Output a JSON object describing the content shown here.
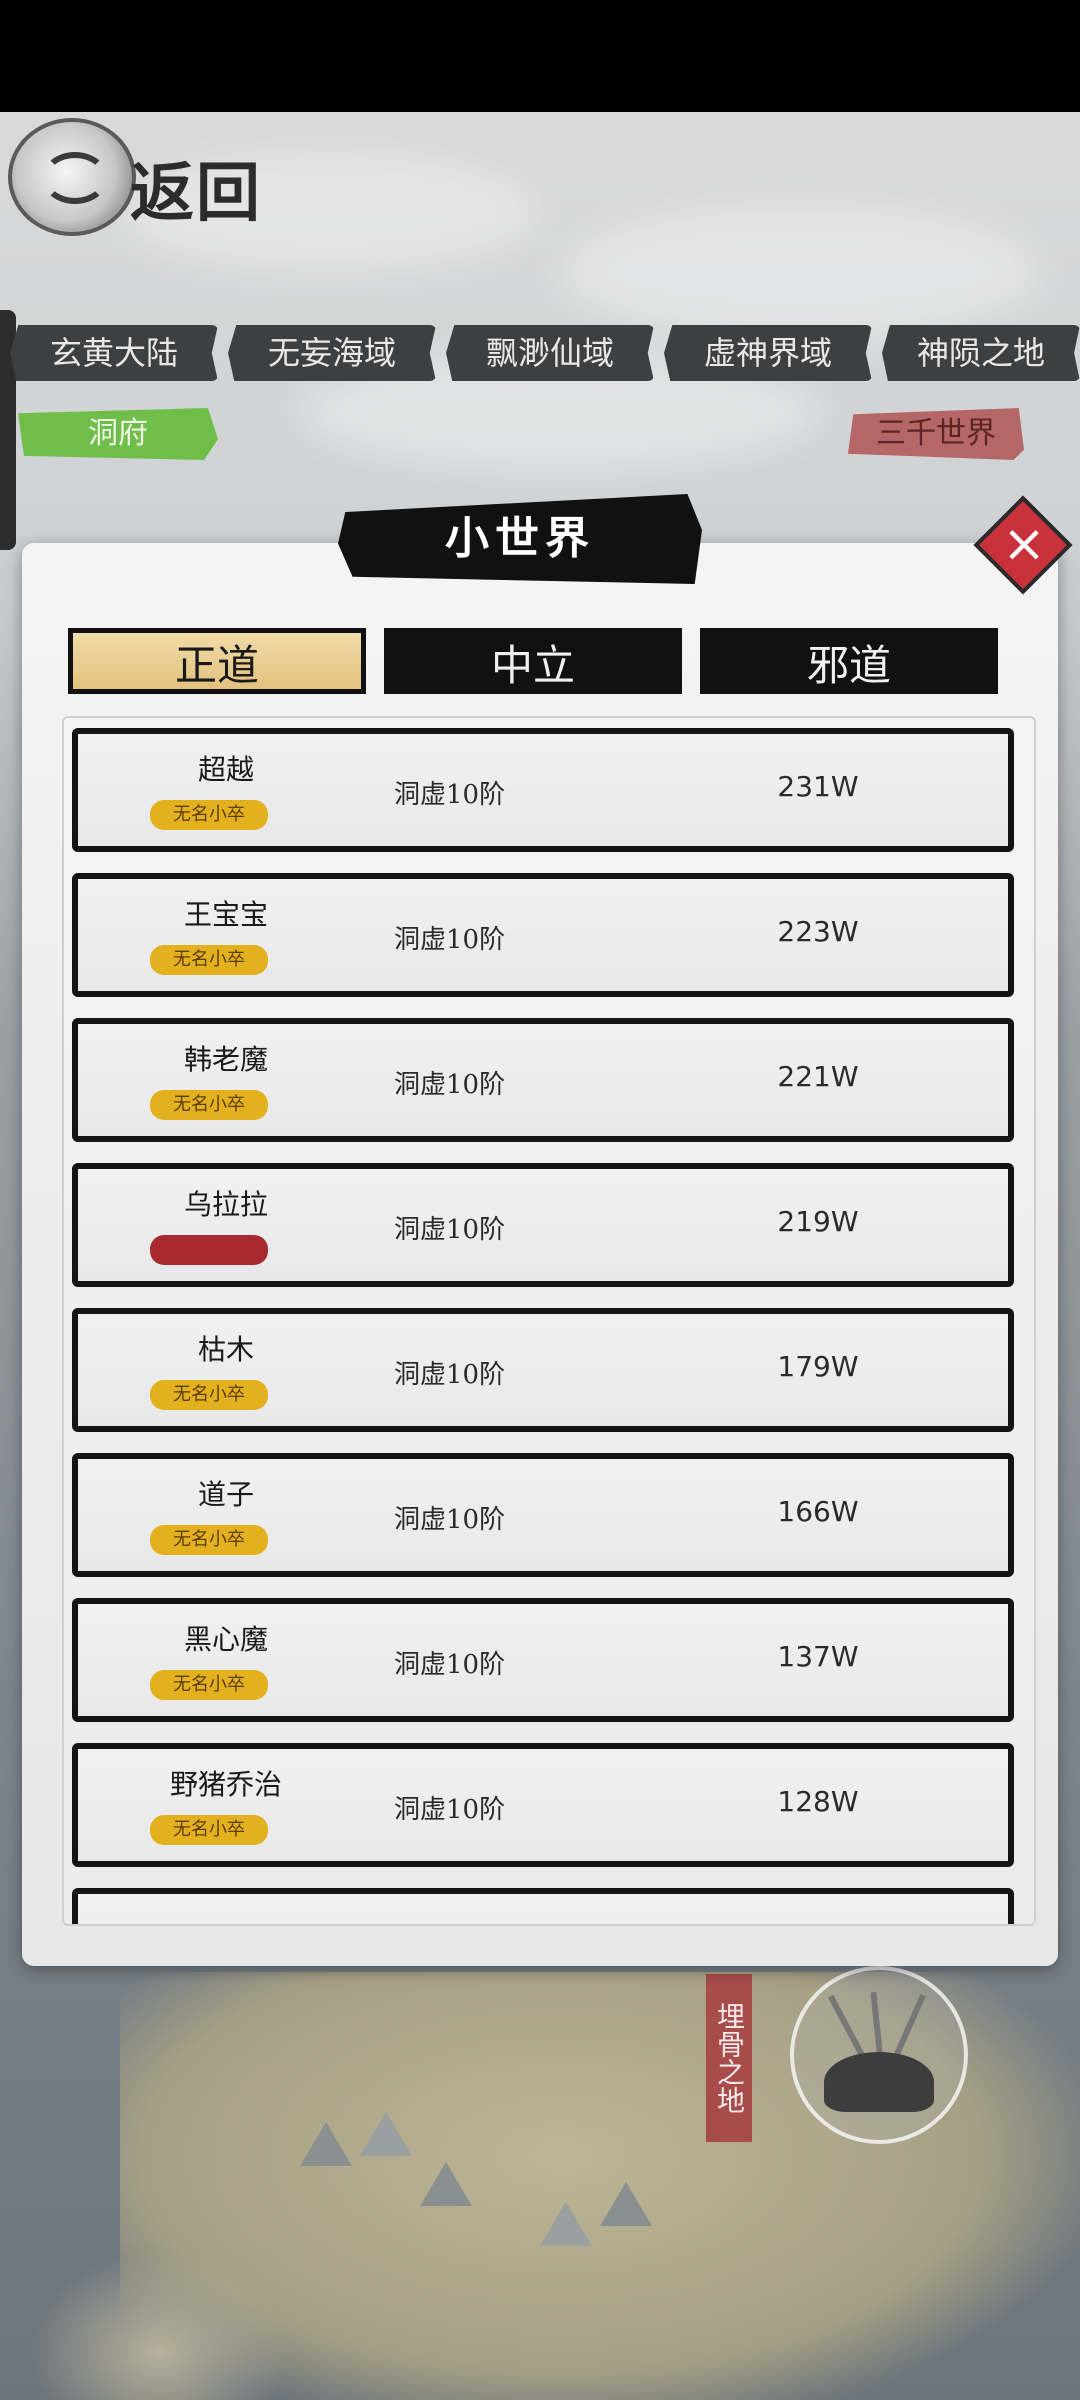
{
  "header": {
    "back_label": "返回"
  },
  "regions": [
    {
      "label": "玄黄大陆"
    },
    {
      "label": "无妄海域"
    },
    {
      "label": "飘渺仙域"
    },
    {
      "label": "虚神界域"
    },
    {
      "label": "神陨之地"
    }
  ],
  "sub_tags": {
    "cave": "洞府",
    "three_thousand_worlds": "三千世界"
  },
  "panel": {
    "title": "小世界",
    "close_icon": "×"
  },
  "faction_tabs": [
    {
      "label": "正道",
      "active": true
    },
    {
      "label": "中立",
      "active": false
    },
    {
      "label": "邪道",
      "active": false
    }
  ],
  "rankings": [
    {
      "name": "超越",
      "badge": "无名小卒",
      "realm": "洞虚10阶",
      "power": "231W"
    },
    {
      "name": "王宝宝",
      "badge": "无名小卒",
      "realm": "洞虚10阶",
      "power": "223W"
    },
    {
      "name": "韩老魔",
      "badge": "无名小卒",
      "realm": "洞虚10阶",
      "power": "221W"
    },
    {
      "name": "乌拉拉",
      "badge": "",
      "realm": "洞虚10阶",
      "power": "219W"
    },
    {
      "name": "枯木",
      "badge": "无名小卒",
      "realm": "洞虚10阶",
      "power": "179W"
    },
    {
      "name": "道子",
      "badge": "无名小卒",
      "realm": "洞虚10阶",
      "power": "166W"
    },
    {
      "name": "黑心魔",
      "badge": "无名小卒",
      "realm": "洞虚10阶",
      "power": "137W"
    },
    {
      "name": "野猪乔治",
      "badge": "无名小卒",
      "realm": "洞虚10阶",
      "power": "128W"
    }
  ],
  "map": {
    "location_sign": "埋骨之地"
  },
  "colors": {
    "active_tab": "#e2c27e",
    "badge_gold": "#e3b11e",
    "badge_red": "#a82a2e",
    "close_button": "#c9313b",
    "cave_tag": "#6fbe4a",
    "worlds_tag": "#b56666"
  }
}
